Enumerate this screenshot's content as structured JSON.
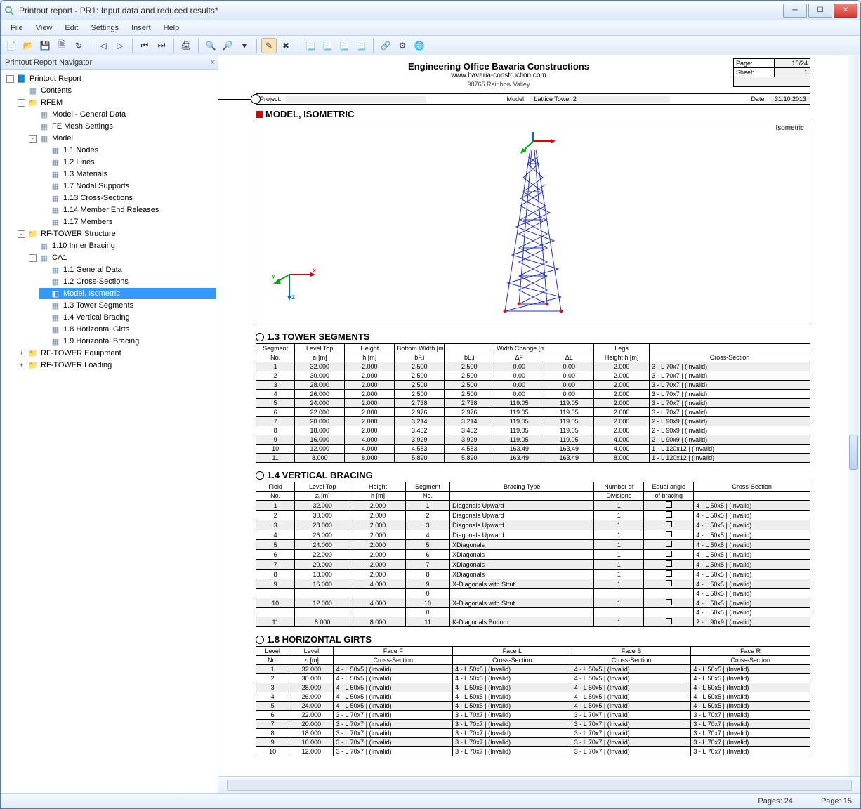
{
  "window": {
    "title": "Printout report - PR1: Input data and reduced results*"
  },
  "menus": [
    "File",
    "View",
    "Edit",
    "Settings",
    "Insert",
    "Help"
  ],
  "nav": {
    "header": "Printout Report Navigator",
    "tree": [
      {
        "label": "Printout Report",
        "icon": "report",
        "expand": "-",
        "children": [
          {
            "label": "Contents",
            "icon": "doc"
          },
          {
            "label": "RFEM",
            "icon": "folder",
            "expand": "-",
            "children": [
              {
                "label": "Model - General Data",
                "icon": "doc"
              },
              {
                "label": "FE Mesh Settings",
                "icon": "doc"
              },
              {
                "label": "Model",
                "icon": "doc",
                "expand": "-",
                "children": [
                  {
                    "label": "1.1 Nodes",
                    "icon": "doc"
                  },
                  {
                    "label": "1.2 Lines",
                    "icon": "doc"
                  },
                  {
                    "label": "1.3 Materials",
                    "icon": "doc"
                  },
                  {
                    "label": "1.7 Nodal Supports",
                    "icon": "doc"
                  },
                  {
                    "label": "1.13 Cross-Sections",
                    "icon": "doc"
                  },
                  {
                    "label": "1.14 Member End Releases",
                    "icon": "doc"
                  },
                  {
                    "label": "1.17 Members",
                    "icon": "doc"
                  }
                ]
              }
            ]
          },
          {
            "label": "RF-TOWER Structure",
            "icon": "folder",
            "expand": "-",
            "children": [
              {
                "label": "1.10 Inner Bracing",
                "icon": "doc"
              },
              {
                "label": "CA1",
                "icon": "doc",
                "expand": "-",
                "children": [
                  {
                    "label": "1.1 General Data",
                    "icon": "doc"
                  },
                  {
                    "label": "1.2 Cross-Sections",
                    "icon": "doc"
                  },
                  {
                    "label": "Model, Isometric",
                    "icon": "iso",
                    "selected": true
                  },
                  {
                    "label": "1.3 Tower Segments",
                    "icon": "doc"
                  },
                  {
                    "label": "1.4 Vertical Bracing",
                    "icon": "doc"
                  },
                  {
                    "label": "1.8 Horizontal Girts",
                    "icon": "doc"
                  },
                  {
                    "label": "1.9 Horizontal Bracing",
                    "icon": "doc"
                  }
                ]
              }
            ]
          },
          {
            "label": "RF-TOWER Equipment",
            "icon": "folder",
            "expand": "+"
          },
          {
            "label": "RF-TOWER Loading",
            "icon": "folder",
            "expand": "+"
          }
        ]
      }
    ]
  },
  "report": {
    "company": "Engineering Office Bavaria Constructions",
    "url": "www.bavaria-construction.com",
    "addr": "98765 Rainbow Valley",
    "page_label": "Page:",
    "page": "15/24",
    "sheet_label": "Sheet:",
    "sheet": "1",
    "project_label": "Project:",
    "project": "",
    "model_label": "Model:",
    "model": "Lattice Tower 2",
    "date_label": "Date:",
    "date": "31.10.2013",
    "section_iso": "MODEL, ISOMETRIC",
    "iso_label": "Isometric",
    "section_13": "1.3 TOWER SEGMENTS",
    "tbl13": {
      "head1": [
        "Segment",
        "Level Top",
        "Height",
        "Bottom Width [m]",
        "",
        "Width Change [mm/m]",
        "",
        "Legs",
        ""
      ],
      "head2": [
        "No.",
        "zᵢ [m]",
        "h [m]",
        "bF,i",
        "bL,i",
        "ΔF",
        "ΔL",
        "Height h [m]",
        "Cross-Section"
      ],
      "rows": [
        [
          "1",
          "32.000",
          "2.000",
          "2.500",
          "2.500",
          "0.00",
          "0.00",
          "2.000",
          "3 - L 70x7 | (Invalid)"
        ],
        [
          "2",
          "30.000",
          "2.000",
          "2.500",
          "2.500",
          "0.00",
          "0.00",
          "2.000",
          "3 - L 70x7 | (Invalid)"
        ],
        [
          "3",
          "28.000",
          "2.000",
          "2.500",
          "2.500",
          "0.00",
          "0.00",
          "2.000",
          "3 - L 70x7 | (Invalid)"
        ],
        [
          "4",
          "26.000",
          "2.000",
          "2.500",
          "2.500",
          "0.00",
          "0.00",
          "2.000",
          "3 - L 70x7 | (Invalid)"
        ],
        [
          "5",
          "24.000",
          "2.000",
          "2.738",
          "2.738",
          "119.05",
          "119.05",
          "2.000",
          "3 - L 70x7 | (Invalid)"
        ],
        [
          "6",
          "22.000",
          "2.000",
          "2.976",
          "2.976",
          "119.05",
          "119.05",
          "2.000",
          "3 - L 70x7 | (Invalid)"
        ],
        [
          "7",
          "20.000",
          "2.000",
          "3.214",
          "3.214",
          "119.05",
          "119.05",
          "2.000",
          "2 - L 90x9 | (Invalid)"
        ],
        [
          "8",
          "18.000",
          "2.000",
          "3.452",
          "3.452",
          "119.05",
          "119.05",
          "2.000",
          "2 - L 90x9 | (Invalid)"
        ],
        [
          "9",
          "16.000",
          "4.000",
          "3.929",
          "3.929",
          "119.05",
          "119.05",
          "4.000",
          "2 - L 90x9 | (Invalid)"
        ],
        [
          "10",
          "12.000",
          "4.000",
          "4.583",
          "4.583",
          "163.49",
          "163.49",
          "4.000",
          "1 - L 120x12 | (Invalid)"
        ],
        [
          "11",
          "8.000",
          "8.000",
          "5.890",
          "5.890",
          "163.49",
          "163.49",
          "8.000",
          "1 - L 120x12 | (Invalid)"
        ]
      ]
    },
    "section_14": "1.4 VERTICAL BRACING",
    "tbl14": {
      "head1": [
        "Field",
        "Level Top",
        "Height",
        "Segment",
        "Bracing Type",
        "Number of",
        "Equal angle",
        "Cross-Section"
      ],
      "head2": [
        "No.",
        "zᵢ [m]",
        "h [m]",
        "No.",
        "",
        "Divisions",
        "of bracing",
        ""
      ],
      "rows": [
        [
          "1",
          "32.000",
          "2.000",
          "1",
          "Diagonals Upward",
          "1",
          "□",
          "4 - L 50x5 | (Invalid)"
        ],
        [
          "2",
          "30.000",
          "2.000",
          "2",
          "Diagonals Upward",
          "1",
          "□",
          "4 - L 50x5 | (Invalid)"
        ],
        [
          "3",
          "28.000",
          "2.000",
          "3",
          "Diagonals Upward",
          "1",
          "□",
          "4 - L 50x5 | (Invalid)"
        ],
        [
          "4",
          "26.000",
          "2.000",
          "4",
          "Diagonals Upward",
          "1",
          "□",
          "4 - L 50x5 | (Invalid)"
        ],
        [
          "5",
          "24.000",
          "2.000",
          "5",
          "XDiagonals",
          "1",
          "□",
          "4 - L 50x5 | (Invalid)"
        ],
        [
          "6",
          "22.000",
          "2.000",
          "6",
          "XDiagonals",
          "1",
          "□",
          "4 - L 50x5 | (Invalid)"
        ],
        [
          "7",
          "20.000",
          "2.000",
          "7",
          "XDiagonals",
          "1",
          "□",
          "4 - L 50x5 | (Invalid)"
        ],
        [
          "8",
          "18.000",
          "2.000",
          "8",
          "XDiagonals",
          "1",
          "□",
          "4 - L 50x5 | (Invalid)"
        ],
        [
          "9",
          "16.000",
          "4.000",
          "9",
          "X-Diagonals with Strut",
          "1",
          "□",
          "4 - L 50x5 | (Invalid)"
        ],
        [
          "",
          "",
          "",
          "0",
          "",
          "",
          "",
          "4 - L 50x5 | (Invalid)"
        ],
        [
          "10",
          "12.000",
          "4.000",
          "10",
          "X-Diagonals with Strut",
          "1",
          "□",
          "4 - L 50x5 | (Invalid)"
        ],
        [
          "",
          "",
          "",
          "0",
          "",
          "",
          "",
          "4 - L 50x5 | (Invalid)"
        ],
        [
          "11",
          "8.000",
          "8.000",
          "11",
          "K-Diagonals Bottom",
          "1",
          "□",
          "2 - L 90x9 | (Invalid)"
        ]
      ]
    },
    "section_18": "1.8 HORIZONTAL GIRTS",
    "tbl18": {
      "head1": [
        "Level",
        "Level",
        "Face F",
        "Face L",
        "Face B",
        "Face R"
      ],
      "head2": [
        "No.",
        "zᵢ [m]",
        "Cross-Section",
        "Cross-Section",
        "Cross-Section",
        "Cross-Section"
      ],
      "rows": [
        [
          "1",
          "32.000",
          "4 - L 50x5 | (Invalid)",
          "4 - L 50x5 | (Invalid)",
          "4 - L 50x5 | (Invalid)",
          "4 - L 50x5 | (Invalid)"
        ],
        [
          "2",
          "30.000",
          "4 - L 50x5 | (Invalid)",
          "4 - L 50x5 | (Invalid)",
          "4 - L 50x5 | (Invalid)",
          "4 - L 50x5 | (Invalid)"
        ],
        [
          "3",
          "28.000",
          "4 - L 50x5 | (Invalid)",
          "4 - L 50x5 | (Invalid)",
          "4 - L 50x5 | (Invalid)",
          "4 - L 50x5 | (Invalid)"
        ],
        [
          "4",
          "26.000",
          "4 - L 50x5 | (Invalid)",
          "4 - L 50x5 | (Invalid)",
          "4 - L 50x5 | (Invalid)",
          "4 - L 50x5 | (Invalid)"
        ],
        [
          "5",
          "24.000",
          "4 - L 50x5 | (Invalid)",
          "4 - L 50x5 | (Invalid)",
          "4 - L 50x5 | (Invalid)",
          "4 - L 50x5 | (Invalid)"
        ],
        [
          "6",
          "22.000",
          "3 - L 70x7 | (Invalid)",
          "3 - L 70x7 | (Invalid)",
          "3 - L 70x7 | (Invalid)",
          "3 - L 70x7 | (Invalid)"
        ],
        [
          "7",
          "20.000",
          "3 - L 70x7 | (Invalid)",
          "3 - L 70x7 | (Invalid)",
          "3 - L 70x7 | (Invalid)",
          "3 - L 70x7 | (Invalid)"
        ],
        [
          "8",
          "18.000",
          "3 - L 70x7 | (Invalid)",
          "3 - L 70x7 | (Invalid)",
          "3 - L 70x7 | (Invalid)",
          "3 - L 70x7 | (Invalid)"
        ],
        [
          "9",
          "16.000",
          "3 - L 70x7 | (Invalid)",
          "3 - L 70x7 | (Invalid)",
          "3 - L 70x7 | (Invalid)",
          "3 - L 70x7 | (Invalid)"
        ],
        [
          "10",
          "12.000",
          "3 - L 70x7 | (Invalid)",
          "3 - L 70x7 | (Invalid)",
          "3 - L 70x7 | (Invalid)",
          "3 - L 70x7 | (Invalid)"
        ]
      ]
    }
  },
  "status": {
    "pages_label": "Pages:",
    "pages": "24",
    "page_label": "Page:",
    "page": "15"
  }
}
